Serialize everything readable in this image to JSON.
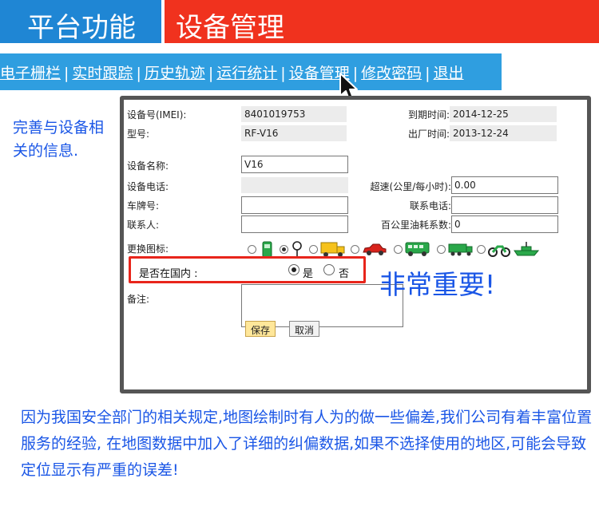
{
  "header": {
    "left_tab": "平台功能",
    "right_tab": "设备管理",
    "colors": {
      "left_bg": "#1f86d4",
      "right_bg": "#f0321e"
    }
  },
  "nav": {
    "items": [
      "电子栅栏",
      "实时跟踪",
      "历史轨迹",
      "运行统计",
      "设备管理",
      "修改密码",
      "退出"
    ],
    "separator": "|"
  },
  "side_note": "完善与设备相关的信息.",
  "form": {
    "imei_label": "设备号(IMEI):",
    "imei_value": "8401019753",
    "expire_label": "到期时间:",
    "expire_value": "2014-12-25",
    "model_label": "型号:",
    "model_value": "RF-V16",
    "factory_label": "出厂时间:",
    "factory_value": "2013-12-24",
    "name_label": "设备名称:",
    "name_value": "V16",
    "phone_label": "设备电话:",
    "phone_value": "",
    "speed_label": "超速(公里/每小时):",
    "speed_value": "0.00",
    "plate_label": "车牌号:",
    "plate_value": "",
    "contact_phone_label": "联系电话:",
    "contact_phone_value": "",
    "contact_label": "联系人:",
    "contact_value": "",
    "fuel_label": "百公里油耗系数:",
    "fuel_value": "0",
    "icon_label": "更换图标:",
    "icons": [
      "fuel-pump-icon",
      "map-pin-icon",
      "truck-icon",
      "car-icon",
      "bus-icon",
      "freight-truck-icon",
      "motorcycle-icon",
      "boat-icon"
    ],
    "selected_icon": "map-pin-icon",
    "domestic_label": "是否在国内 :",
    "domestic_yes": "是",
    "domestic_no": "否",
    "domestic_value": "是",
    "remark_label": "备注:",
    "remark_value": "",
    "save_button": "保存",
    "cancel_button": "取消"
  },
  "callout": "非常重要!",
  "bottom_note": "因为我国安全部门的相关规定,地图绘制时有人为的做一些偏差,我们公司有着丰富位置服务的经验, 在地图数据中加入了详细的纠偏数据,如果不选择使用的地区,可能会导致定位显示有严重的误差!",
  "colors": {
    "note_blue": "#1a56e6",
    "highlight_red": "#e8251b",
    "nav_bg": "#2f9ee0"
  }
}
